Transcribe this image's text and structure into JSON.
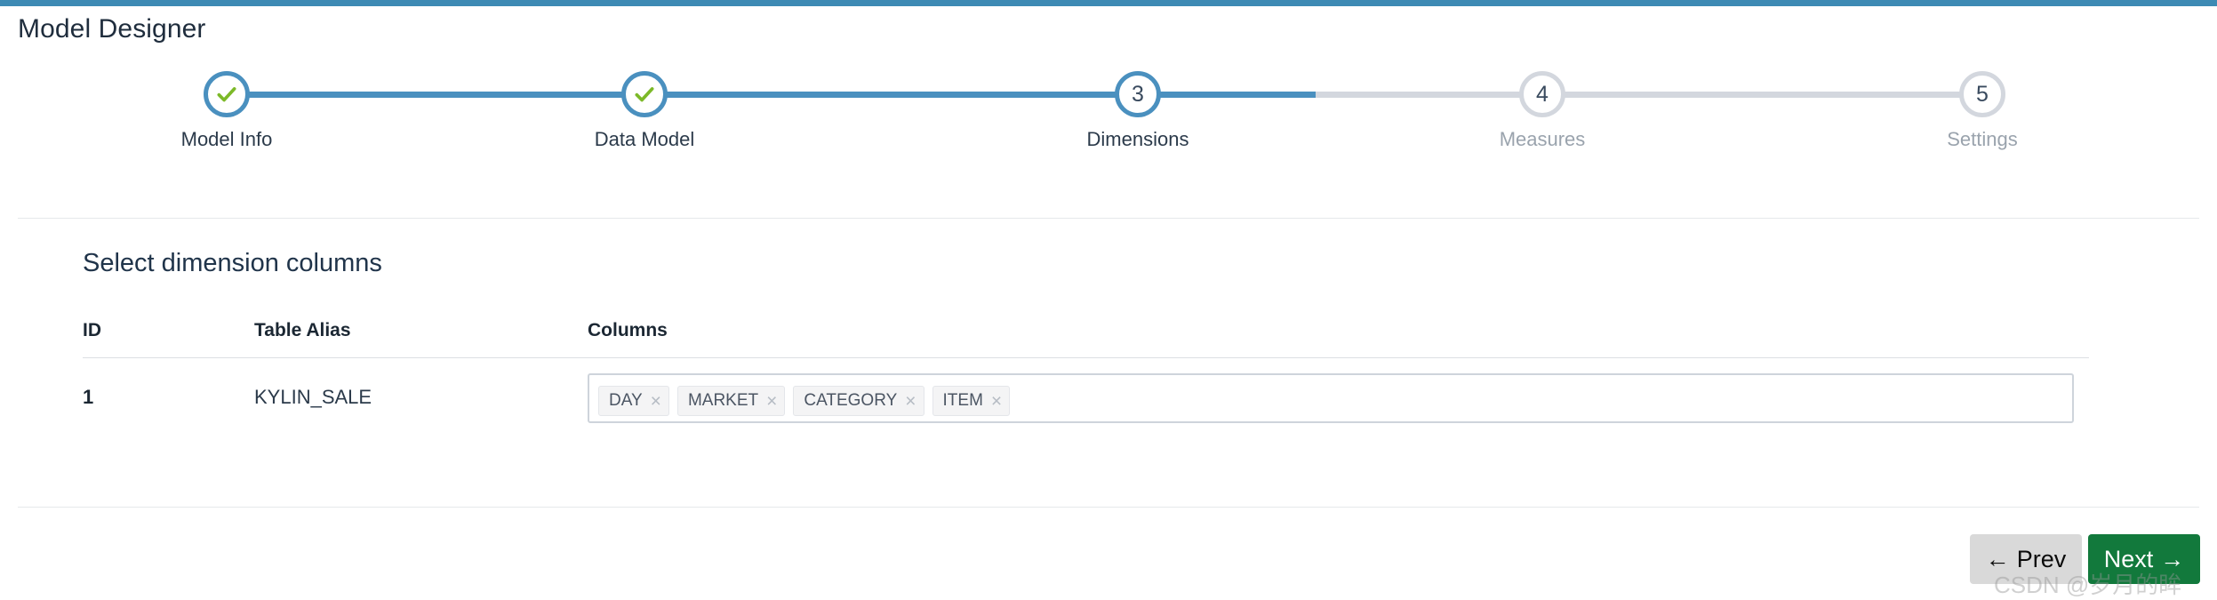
{
  "page": {
    "title": "Model Designer",
    "accent_color": "#3d8ab4"
  },
  "stepper": {
    "active_index": 2,
    "steps": [
      {
        "number": "1",
        "label": "Model Info",
        "state": "done",
        "icon": "check-icon"
      },
      {
        "number": "2",
        "label": "Data Model",
        "state": "done",
        "icon": "check-icon"
      },
      {
        "number": "3",
        "label": "Dimensions",
        "state": "active",
        "icon": ""
      },
      {
        "number": "4",
        "label": "Measures",
        "state": "pending",
        "icon": ""
      },
      {
        "number": "5",
        "label": "Settings",
        "state": "pending",
        "icon": ""
      }
    ],
    "colors": {
      "done": "#4a90bf",
      "active": "#4a90bf",
      "pending": "#d3d7de",
      "check": "#7cb928"
    }
  },
  "section": {
    "heading": "Select dimension columns"
  },
  "table": {
    "headers": {
      "id": "ID",
      "table_alias": "Table Alias",
      "columns": "Columns"
    },
    "rows": [
      {
        "id": "1",
        "table_alias": "KYLIN_SALE",
        "columns": [
          "DAY",
          "MARKET",
          "CATEGORY",
          "ITEM"
        ],
        "remove_icon": "×"
      }
    ]
  },
  "footer": {
    "prev_label": "Prev",
    "prev_icon": "←",
    "next_label": "Next",
    "next_icon": "→",
    "prev_color": "#d9d9d9",
    "next_color": "#12793c"
  },
  "watermark": {
    "text": "CSDN @岁月的眸"
  }
}
